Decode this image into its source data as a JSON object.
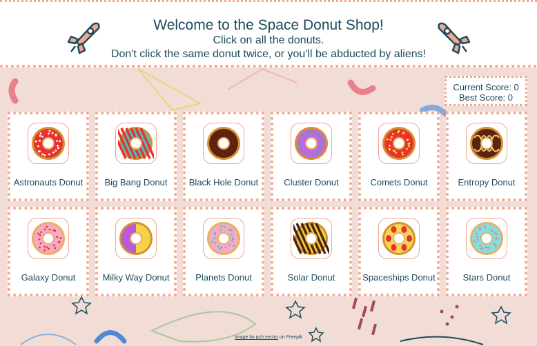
{
  "header": {
    "title": "Welcome to the Space Donut Shop!",
    "line1": "Click on all the donuts.",
    "line2": "Don't click the same donut twice, or you'll be abducted by aliens!"
  },
  "score": {
    "current": "Current Score: 0",
    "best": "Best Score: 0"
  },
  "donuts": [
    {
      "name": "Astronauts Donut",
      "glaze": "#e8322f",
      "ring": "#d9902e",
      "sprinkles": "#ffffff",
      "style": "dots"
    },
    {
      "name": "Big Bang Donut",
      "glaze": "#43c6c1",
      "ring": "#d9902e",
      "sprinkles": "#e8322f",
      "style": "stripes"
    },
    {
      "name": "Black Hole Donut",
      "glaze": "#5a2410",
      "ring": "#d9902e",
      "sprinkles": "#5a2410",
      "style": "plain"
    },
    {
      "name": "Cluster Donut",
      "glaze": "#c266e6",
      "ring": "#d9902e",
      "sprinkles": "#3fb08a",
      "style": "cluster"
    },
    {
      "name": "Comets Donut",
      "glaze": "#e8322f",
      "ring": "#d9902e",
      "sprinkles": "#f7e34a",
      "style": "dots"
    },
    {
      "name": "Entropy Donut",
      "glaze": "#5a2410",
      "ring": "#d9902e",
      "sprinkles": "#f4c77a",
      "style": "drizzle"
    },
    {
      "name": "Galaxy Donut",
      "glaze": "#f7a9c6",
      "ring": "#e8b060",
      "sprinkles": "#e8322f",
      "style": "dots"
    },
    {
      "name": "Milky Way Donut",
      "glaze": "#b85ad9",
      "ring": "#d9902e",
      "sprinkles": "#f4d24a",
      "style": "half"
    },
    {
      "name": "Planets Donut",
      "glaze": "#f7a9c6",
      "ring": "#e8b060",
      "sprinkles": "#43c6c1",
      "style": "dots"
    },
    {
      "name": "Solar Donut",
      "glaze": "#f2cc3a",
      "ring": "#d9902e",
      "sprinkles": "#4a2410",
      "style": "bars"
    },
    {
      "name": "Spaceships Donut",
      "glaze": "#f7d45a",
      "ring": "#d9902e",
      "sprinkles": "#e8322f",
      "style": "berries"
    },
    {
      "name": "Stars Donut",
      "glaze": "#7fe0dc",
      "ring": "#e8b060",
      "sprinkles": "#f07ab0",
      "style": "dots"
    }
  ],
  "credit": {
    "link": "Image by pch.vector",
    "suffix": " on Freepik"
  }
}
